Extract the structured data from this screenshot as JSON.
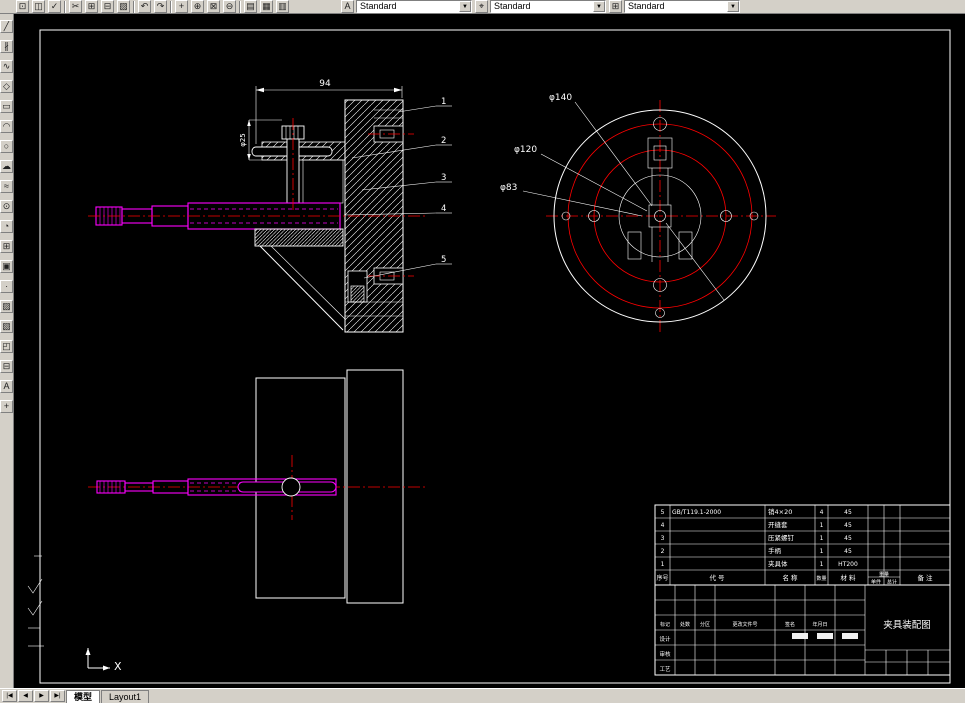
{
  "window": {
    "colors": {
      "chrome": "#d4d0c8",
      "canvas_bg": "#000000",
      "outline": "#ffffff",
      "centerline": "#ff0000",
      "highlight_part": "#ff00ff"
    }
  },
  "ui": {
    "dropdown_arrow": "▼"
  },
  "top_toolbar": {
    "icons": [
      {
        "name": "print-icon",
        "glyph": "⊡"
      },
      {
        "name": "print-preview-icon",
        "glyph": "◫"
      },
      {
        "name": "spelling-icon",
        "glyph": "✓"
      },
      {
        "name": "cut-icon",
        "glyph": "✂"
      },
      {
        "name": "copy-icon",
        "glyph": "⊞"
      },
      {
        "name": "paste-icon",
        "glyph": "⊟"
      },
      {
        "name": "match-properties-icon",
        "glyph": "▨"
      },
      {
        "name": "undo-icon",
        "glyph": "↶"
      },
      {
        "name": "redo-icon",
        "glyph": "↷"
      },
      {
        "name": "pan-icon",
        "glyph": "+"
      },
      {
        "name": "zoom-realtime-icon",
        "glyph": "⊕"
      },
      {
        "name": "zoom-window-icon",
        "glyph": "⊠"
      },
      {
        "name": "zoom-previous-icon",
        "glyph": "⊖"
      },
      {
        "name": "properties-icon",
        "glyph": "▤"
      },
      {
        "name": "designcenter-icon",
        "glyph": "▦"
      },
      {
        "name": "tool-palettes-icon",
        "glyph": "▥"
      }
    ],
    "style_groups": [
      {
        "icon": "text-style-icon",
        "glyph": "A",
        "value": "Standard"
      },
      {
        "icon": "dim-style-icon",
        "glyph": "⌖",
        "value": "Standard"
      },
      {
        "icon": "table-style-icon",
        "glyph": "⊞",
        "value": "Standard"
      }
    ]
  },
  "left_toolbar": {
    "icons": [
      {
        "name": "line-icon",
        "glyph": "╱"
      },
      {
        "name": "construction-line-icon",
        "glyph": "∦"
      },
      {
        "name": "polyline-icon",
        "glyph": "∿"
      },
      {
        "name": "polygon-icon",
        "glyph": "◇"
      },
      {
        "name": "rectangle-icon",
        "glyph": "▭"
      },
      {
        "name": "arc-icon",
        "glyph": "◠"
      },
      {
        "name": "circle-icon",
        "glyph": "○"
      },
      {
        "name": "revision-cloud-icon",
        "glyph": "☁"
      },
      {
        "name": "spline-icon",
        "glyph": "≈"
      },
      {
        "name": "ellipse-icon",
        "glyph": "⊙"
      },
      {
        "name": "ellipse-arc-icon",
        "glyph": "◔"
      },
      {
        "name": "insert-block-icon",
        "glyph": "⊞"
      },
      {
        "name": "make-block-icon",
        "glyph": "▣"
      },
      {
        "name": "point-icon",
        "glyph": "∙"
      },
      {
        "name": "hatch-icon",
        "glyph": "▨"
      },
      {
        "name": "gradient-icon",
        "glyph": "▧"
      },
      {
        "name": "region-icon",
        "glyph": "◰"
      },
      {
        "name": "table-icon",
        "glyph": "⊟"
      },
      {
        "name": "multiline-text-icon",
        "glyph": "A"
      },
      {
        "name": "move-icon",
        "glyph": "+"
      }
    ]
  },
  "tab_bar": {
    "nav": [
      "|◀",
      "◀",
      "▶",
      "▶|"
    ],
    "tabs": [
      "模型",
      "Layout1"
    ]
  },
  "drawing": {
    "section_view": {
      "width_dim": "94",
      "side_dim": "φ25",
      "balloons": [
        "1",
        "2",
        "3",
        "4",
        "5"
      ]
    },
    "circular_view": {
      "dia_outer": "φ140",
      "dia_mid": "φ120",
      "dia_inner": "φ83"
    },
    "ucs": {
      "axis_label": "X"
    },
    "parts_list": {
      "headers": {
        "no": "序号",
        "code": "代 号",
        "name": "名 称",
        "qty": "数量",
        "material": "材 料",
        "weight": "重量",
        "weight_unit": "单件",
        "weight_total": "总计",
        "remark": "备 注"
      },
      "rows": [
        {
          "no": "5",
          "code": "GB/T119.1-2000",
          "name": "销4×20",
          "qty": "4",
          "material": "45"
        },
        {
          "no": "4",
          "code": "",
          "name": "开缝套",
          "qty": "1",
          "material": "45"
        },
        {
          "no": "3",
          "code": "",
          "name": "压紧螺钉",
          "qty": "1",
          "material": "45"
        },
        {
          "no": "2",
          "code": "",
          "name": "手柄",
          "qty": "1",
          "material": "45"
        },
        {
          "no": "1",
          "code": "",
          "name": "夹具体",
          "qty": "1",
          "material": "HT200"
        }
      ]
    },
    "title_block": {
      "revision_cols": [
        "标记",
        "处数",
        "分区",
        "更改文件号",
        "签名",
        "年月日"
      ],
      "roles": [
        "设计",
        "审核",
        "工艺"
      ],
      "title": "夹具装配图"
    }
  }
}
